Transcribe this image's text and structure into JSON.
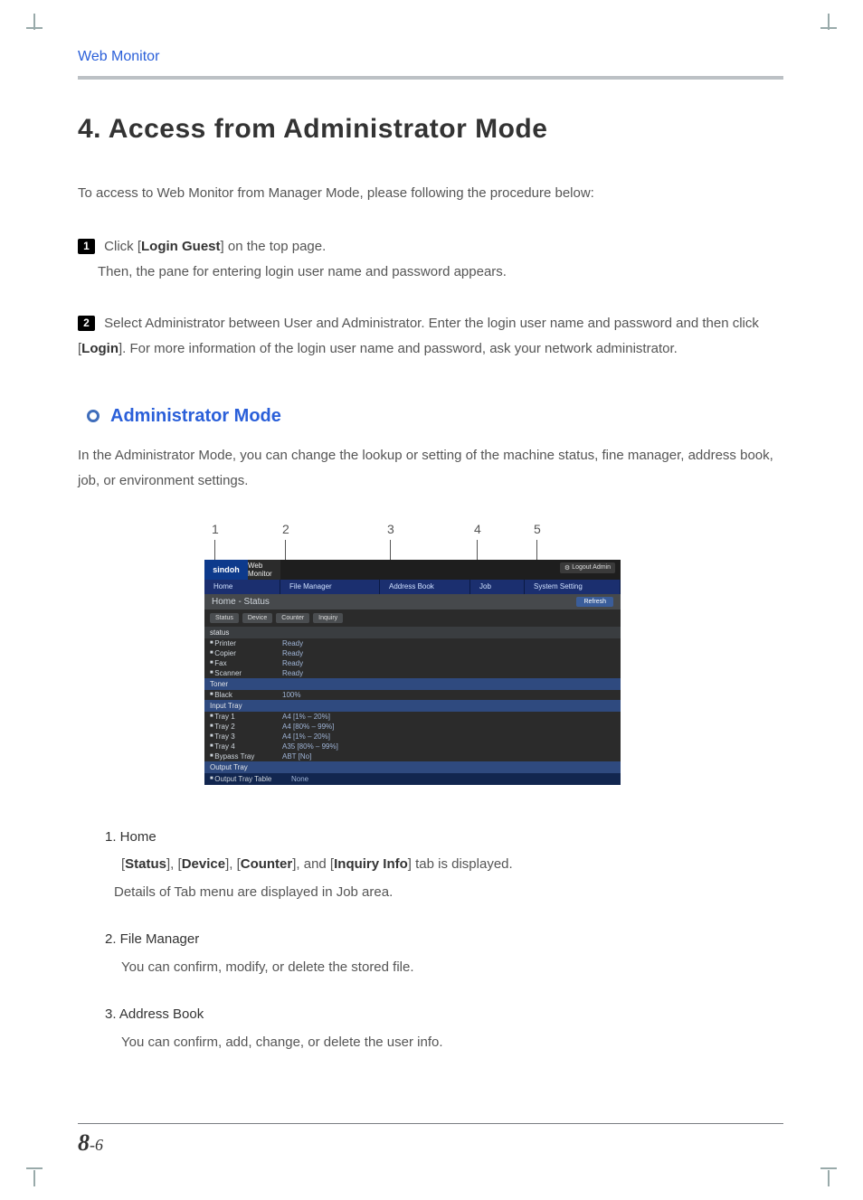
{
  "header": {
    "title": "Web Monitor"
  },
  "main_heading_prefix": "4.",
  "main_heading": "Access from Administrator Mode",
  "intro": "To access to Web Monitor from Manager Mode, please following the procedure below:",
  "steps": [
    {
      "marker": "1",
      "pre": "Click [",
      "bold": "Login Guest",
      "post": "] on the top page.",
      "line2": "Then, the pane for entering login user name and password appears."
    },
    {
      "marker": "2",
      "pre": "Select Administrator between User and Administrator. Enter the login user name and password and then   click [",
      "bold": "Login",
      "post": "]. For more information of the login user name and password, ask your network administrator."
    }
  ],
  "subheading": "Administrator Mode",
  "subpara": "In the Administrator Mode, you can change the lookup or setting of the machine status, fine manager, address book, job, or environment settings.",
  "callouts": [
    "1",
    "2",
    "3",
    "4",
    "5"
  ],
  "screenshot": {
    "logo": "sindoh",
    "brand": "Web Monitor",
    "logout": "Logout Admin",
    "nav": [
      "Home",
      "File Manager",
      "Address Book",
      "Job",
      "System Setting"
    ],
    "breadcrumb": "Home - Status",
    "refresh": "Refresh",
    "subtabs": [
      "Status",
      "Device",
      "Counter",
      "Inquiry"
    ],
    "sections": {
      "status": {
        "label": "status",
        "rows": [
          {
            "name": "Printer",
            "val": "Ready"
          },
          {
            "name": "Copier",
            "val": "Ready"
          },
          {
            "name": "Fax",
            "val": "Ready"
          },
          {
            "name": "Scanner",
            "val": "Ready"
          }
        ]
      },
      "toner": {
        "label": "Toner",
        "rows": [
          {
            "name": "Black",
            "val": "100%"
          }
        ]
      },
      "input": {
        "label": "Input Tray",
        "rows": [
          {
            "name": "Tray 1",
            "val": "A4 [1% – 20%]"
          },
          {
            "name": "Tray 2",
            "val": "A4 [80% – 99%]"
          },
          {
            "name": "Tray 3",
            "val": "A4 [1% – 20%]"
          },
          {
            "name": "Tray 4",
            "val": "A35 [80% – 99%]"
          },
          {
            "name": "Bypass Tray",
            "val": "ABT [No]"
          }
        ]
      },
      "output": {
        "label": "Output Tray",
        "rows": [
          {
            "name": "Output Tray Table",
            "val": "None"
          }
        ]
      }
    }
  },
  "list": [
    {
      "title": "1. Home",
      "body_parts": {
        "l1_pre": "[",
        "b1": "Status",
        "sep1": "], [",
        "b2": "Device",
        "sep2": "], [",
        "b3": "Counter",
        "sep3": "], and [",
        "b4": "Inquiry Info",
        "post": "] tab is displayed."
      },
      "body2": "Details of Tab menu are displayed in Job area."
    },
    {
      "title": "2. File Manager",
      "body": "You can confirm, modify, or delete the stored file."
    },
    {
      "title": "3. Address Book",
      "body": "You can confirm, add, change, or delete the user info."
    }
  ],
  "page_number_big": "8",
  "page_number_small": "-6"
}
